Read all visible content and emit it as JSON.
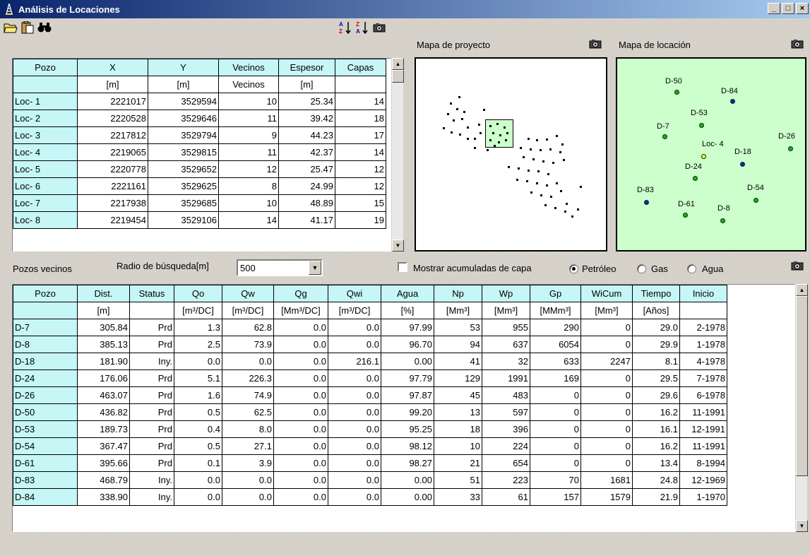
{
  "window": {
    "title": "Análisis de Locaciones"
  },
  "panels": {
    "project_map_label": "Mapa de proyecto",
    "location_map_label": "Mapa de locación",
    "neighbors_label": "Pozos vecinos",
    "search_radius_label": "Radio de búsqueda[m]",
    "search_radius_value": "500",
    "cumulative_label": "Mostrar acumuladas de capa",
    "fluid_options": [
      "Petróleo",
      "Gas",
      "Agua"
    ],
    "selected_fluid": "Petróleo"
  },
  "locations_table": {
    "headers": [
      "Pozo",
      "X",
      "Y",
      "Vecinos",
      "Espesor",
      "Capas"
    ],
    "units": [
      "",
      "[m]",
      "[m]",
      "Vecinos",
      "[m]",
      ""
    ],
    "rows": [
      [
        "Loc- 1",
        "2221017",
        "3529594",
        "10",
        "25.34",
        "14"
      ],
      [
        "Loc- 2",
        "2220528",
        "3529646",
        "11",
        "39.42",
        "18"
      ],
      [
        "Loc- 3",
        "2217812",
        "3529794",
        "9",
        "44.23",
        "17"
      ],
      [
        "Loc- 4",
        "2219065",
        "3529815",
        "11",
        "42.37",
        "14"
      ],
      [
        "Loc- 5",
        "2220778",
        "3529652",
        "12",
        "25.47",
        "12"
      ],
      [
        "Loc- 6",
        "2221161",
        "3529625",
        "8",
        "24.99",
        "12"
      ],
      [
        "Loc- 7",
        "2217938",
        "3529685",
        "10",
        "48.89",
        "15"
      ],
      [
        "Loc- 8",
        "2219454",
        "3529106",
        "14",
        "41.17",
        "19"
      ]
    ]
  },
  "neighbors_table": {
    "headers": [
      "Pozo",
      "Dist.",
      "Status",
      "Qo",
      "Qw",
      "Qg",
      "Qwi",
      "Agua",
      "Np",
      "Wp",
      "Gp",
      "WiCum",
      "Tiempo",
      "Inicio"
    ],
    "units": [
      "",
      "[m]",
      "",
      "[m³/DC]",
      "[m³/DC]",
      "[Mm³/DC]",
      "[m³/DC]",
      "[%]",
      "[Mm³]",
      "[Mm³]",
      "[MMm³]",
      "[Mm³]",
      "[Años]",
      ""
    ],
    "rows": [
      [
        "D-7",
        "305.84",
        "Prd",
        "1.3",
        "62.8",
        "0.0",
        "0.0",
        "97.99",
        "53",
        "955",
        "290",
        "0",
        "29.0",
        "2-1978"
      ],
      [
        "D-8",
        "385.13",
        "Prd",
        "2.5",
        "73.9",
        "0.0",
        "0.0",
        "96.70",
        "94",
        "637",
        "6054",
        "0",
        "29.9",
        "1-1978"
      ],
      [
        "D-18",
        "181.90",
        "Iny.",
        "0.0",
        "0.0",
        "0.0",
        "216.1",
        "0.00",
        "41",
        "32",
        "633",
        "2247",
        "8.1",
        "4-1978"
      ],
      [
        "D-24",
        "176.06",
        "Prd",
        "5.1",
        "226.3",
        "0.0",
        "0.0",
        "97.79",
        "129",
        "1991",
        "169",
        "0",
        "29.5",
        "7-1978"
      ],
      [
        "D-26",
        "463.07",
        "Prd",
        "1.6",
        "74.9",
        "0.0",
        "0.0",
        "97.87",
        "45",
        "483",
        "0",
        "0",
        "29.6",
        "6-1978"
      ],
      [
        "D-50",
        "436.82",
        "Prd",
        "0.5",
        "62.5",
        "0.0",
        "0.0",
        "99.20",
        "13",
        "597",
        "0",
        "0",
        "16.2",
        "11-1991"
      ],
      [
        "D-53",
        "189.73",
        "Prd",
        "0.4",
        "8.0",
        "0.0",
        "0.0",
        "95.25",
        "18",
        "396",
        "0",
        "0",
        "16.1",
        "12-1991"
      ],
      [
        "D-54",
        "367.47",
        "Prd",
        "0.5",
        "27.1",
        "0.0",
        "0.0",
        "98.12",
        "10",
        "224",
        "0",
        "0",
        "16.2",
        "11-1991"
      ],
      [
        "D-61",
        "395.66",
        "Prd",
        "0.1",
        "3.9",
        "0.0",
        "0.0",
        "98.27",
        "21",
        "654",
        "0",
        "0",
        "13.4",
        "8-1994"
      ],
      [
        "D-83",
        "468.79",
        "Iny.",
        "0.0",
        "0.0",
        "0.0",
        "0.0",
        "0.00",
        "51",
        "223",
        "70",
        "1681",
        "24.8",
        "12-1969"
      ],
      [
        "D-84",
        "338.90",
        "Iny.",
        "0.0",
        "0.0",
        "0.0",
        "0.0",
        "0.00",
        "33",
        "61",
        "157",
        "1579",
        "21.9",
        "1-1970"
      ]
    ]
  },
  "location_map": {
    "wells": [
      {
        "name": "D-50",
        "type": "producer",
        "color": "#22aa22"
      },
      {
        "name": "D-84",
        "type": "injector",
        "color": "#1a1acc"
      },
      {
        "name": "D-53",
        "type": "producer",
        "color": "#22aa22"
      },
      {
        "name": "D-7",
        "type": "producer",
        "color": "#22aa22"
      },
      {
        "name": "D-26",
        "type": "producer",
        "color": "#22aa22"
      },
      {
        "name": "Loc- 4",
        "type": "location",
        "color": "#ffee33"
      },
      {
        "name": "D-18",
        "type": "injector",
        "color": "#1a1acc"
      },
      {
        "name": "D-24",
        "type": "producer",
        "color": "#22aa22"
      },
      {
        "name": "D-83",
        "type": "injector",
        "color": "#1a1acc"
      },
      {
        "name": "D-54",
        "type": "producer",
        "color": "#22aa22"
      },
      {
        "name": "D-61",
        "type": "producer",
        "color": "#22aa22"
      },
      {
        "name": "D-8",
        "type": "producer",
        "color": "#22aa22"
      }
    ]
  },
  "toolbar_icons": [
    "open-folder-icon",
    "paste-icon",
    "binoculars-icon",
    "sort-ascending-icon",
    "sort-descending-icon",
    "camera-icon"
  ]
}
